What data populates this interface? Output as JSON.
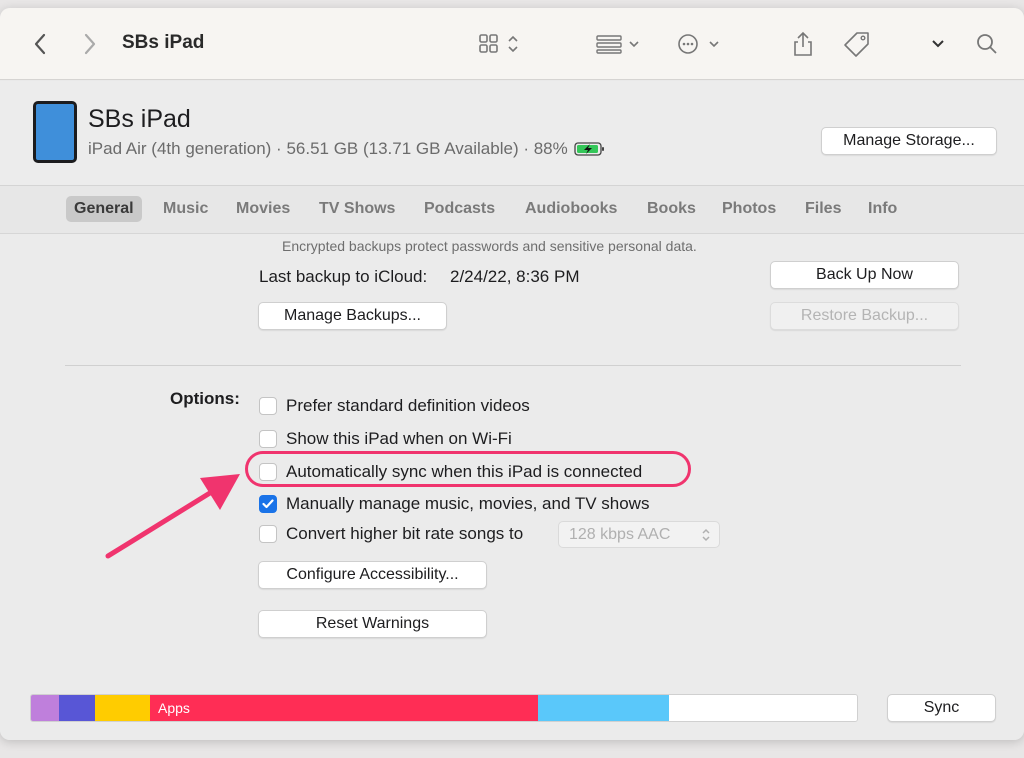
{
  "window": {
    "title": "SBs iPad"
  },
  "toolbar": {
    "icons": [
      "chevron-left-icon",
      "chevron-right-icon",
      "grid-view-icon",
      "group-view-icon",
      "more-icon",
      "share-icon",
      "tag-icon",
      "chevron-down-icon",
      "search-icon"
    ]
  },
  "device": {
    "name": "SBs iPad",
    "info": "iPad Air (4th generation) · 56.51 GB (13.71 GB Available) · 88%",
    "manage_storage_label": "Manage Storage..."
  },
  "tabs": [
    "General",
    "Music",
    "Movies",
    "TV Shows",
    "Podcasts",
    "Audiobooks",
    "Books",
    "Photos",
    "Files",
    "Info"
  ],
  "active_tab": "General",
  "backup": {
    "note": "Encrypted backups protect passwords and sensitive personal data.",
    "last_backup_label": "Last backup to iCloud:",
    "last_backup_value": "2/24/22, 8:36 PM",
    "back_up_now_label": "Back Up Now",
    "manage_backups_label": "Manage Backups...",
    "restore_backup_label": "Restore Backup..."
  },
  "options": {
    "heading": "Options:",
    "items": [
      {
        "label": "Prefer standard definition videos",
        "checked": false
      },
      {
        "label": "Show this iPad when on Wi-Fi",
        "checked": false
      },
      {
        "label": "Automatically sync when this iPad is connected",
        "checked": false
      },
      {
        "label": "Manually manage music, movies, and TV shows",
        "checked": true
      },
      {
        "label": "Convert higher bit rate songs to",
        "checked": false
      }
    ],
    "bitrate_value": "128 kbps AAC",
    "configure_accessibility_label": "Configure Accessibility...",
    "reset_warnings_label": "Reset Warnings"
  },
  "storage": {
    "segments": [
      {
        "color": "#bf7fdc",
        "label": ""
      },
      {
        "color": "#5856d6",
        "label": ""
      },
      {
        "color": "#ffcc00",
        "label": ""
      },
      {
        "color": "#ff2d55",
        "label": "Apps"
      },
      {
        "color": "#5ac8fa",
        "label": ""
      },
      {
        "color": "#ffffff",
        "label": ""
      }
    ],
    "sync_label": "Sync"
  },
  "colors": {
    "accent": "#1a73e8",
    "annotation": "#f0346e"
  }
}
